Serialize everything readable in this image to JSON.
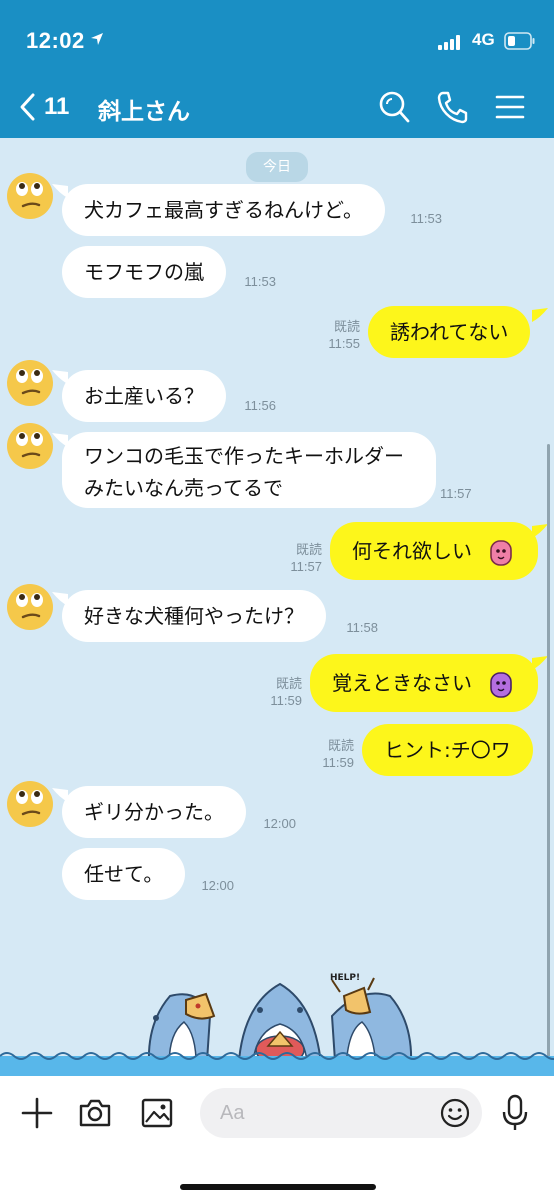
{
  "status_bar": {
    "time": "12:02",
    "network": "4G"
  },
  "header": {
    "back_count": "11",
    "title": "斜上さん"
  },
  "chat": {
    "date_chip": "今日",
    "messages": [
      {
        "side": "in",
        "text": "犬カフェ最高すぎるねんけど。",
        "time": "11:53"
      },
      {
        "side": "in",
        "text": "モフモフの嵐",
        "time": "11:53"
      },
      {
        "side": "out",
        "text": "誘われてない",
        "read": "既読",
        "time": "11:55"
      },
      {
        "side": "in",
        "text": "お土産いる？",
        "time": "11:56"
      },
      {
        "side": "in",
        "text": "ワンコの毛玉で作ったキーホルダーみたいなん売ってるで",
        "time": "11:57"
      },
      {
        "side": "out",
        "text": "何それ欲しい",
        "read": "既読",
        "time": "11:57"
      },
      {
        "side": "in",
        "text": "好きな犬種何やったけ？",
        "time": "11:58"
      },
      {
        "side": "out",
        "text": "覚えときなさい",
        "read": "既読",
        "time": "11:59"
      },
      {
        "side": "out",
        "text": "ヒント:チ〇ワ",
        "read": "既読",
        "time": "11:59"
      },
      {
        "side": "in",
        "text": "ギリ分かった。",
        "time": "12:00"
      },
      {
        "side": "in",
        "text": "任せて。",
        "time": "12:00"
      }
    ],
    "sticker_text": "HELP!"
  },
  "input": {
    "placeholder": "Aa"
  },
  "colors": {
    "header": "#1a8fc4",
    "chat_bg": "#d6e9f5",
    "outgoing_bubble": "#fdf61b",
    "incoming_bubble": "#ffffff"
  }
}
